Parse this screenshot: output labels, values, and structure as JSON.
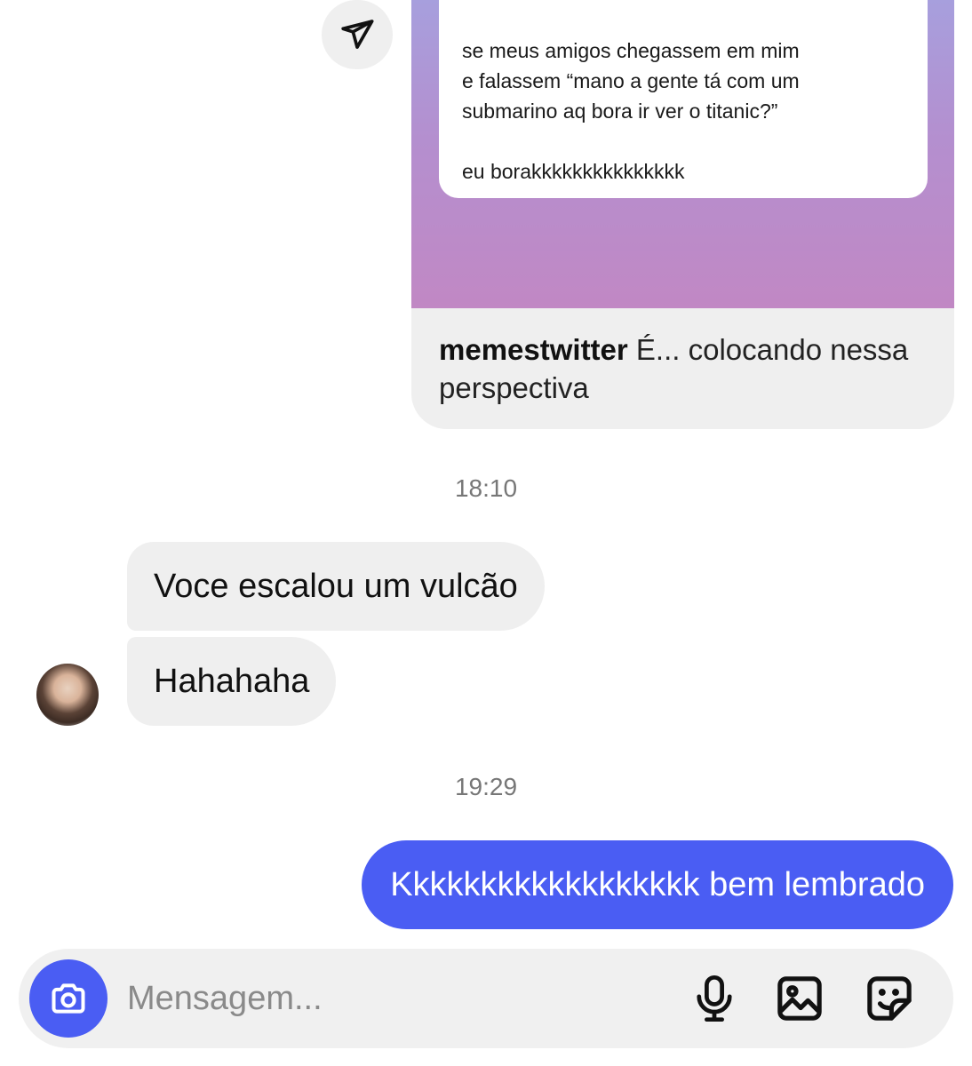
{
  "colors": {
    "accent": "#4a5df3",
    "bubble_incoming": "#efefef",
    "timestamp": "#777777"
  },
  "shared_post": {
    "tweet_lines": [
      "se meus amigos chegassem em mim",
      "e falassem “mano a gente tá com um",
      "submarino aq bora ir ver o titanic?”",
      "eu borakkkkkkkkkkkkkkk"
    ],
    "author": "memestwitter",
    "caption": "É... colocando nessa perspectiva"
  },
  "messages": [
    {
      "type": "timestamp",
      "text": "18:10"
    },
    {
      "type": "incoming",
      "text": "Voce escalou um vulcão"
    },
    {
      "type": "incoming",
      "text": "Hahahaha"
    },
    {
      "type": "timestamp",
      "text": "19:29"
    },
    {
      "type": "outgoing",
      "text": "Kkkkkkkkkkkkkkkkkk bem lembrado"
    }
  ],
  "composer": {
    "placeholder": "Mensagem...",
    "icons": [
      "camera-icon",
      "microphone-icon",
      "image-icon",
      "sticker-icon"
    ]
  }
}
